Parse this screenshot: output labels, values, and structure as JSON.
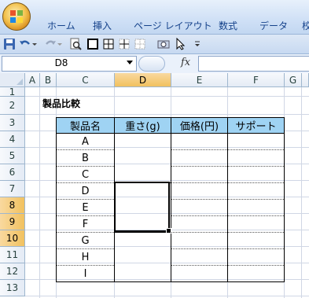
{
  "ribbon": {
    "tabs": [
      "ホーム",
      "挿入",
      "ページ レイアウト",
      "数式",
      "データ",
      "校"
    ]
  },
  "quick_access": {
    "icons": [
      "save-icon",
      "undo-icon",
      "redo-icon",
      "print-preview-icon",
      "border-icon",
      "all-borders-icon",
      "inner-borders-icon",
      "no-border-icon",
      "camera-icon",
      "select-objects-icon",
      "customize-dropdown-icon"
    ]
  },
  "formula_bar": {
    "name_box": "D8",
    "fx_label": "fx",
    "formula": ""
  },
  "grid": {
    "columns": [
      "A",
      "B",
      "C",
      "D",
      "E",
      "F",
      "G"
    ],
    "active_column": "D",
    "rows": [
      "1",
      "2",
      "3",
      "4",
      "5",
      "6",
      "7",
      "8",
      "9",
      "10",
      "11",
      "12",
      "13"
    ],
    "active_rows": [
      "8",
      "9",
      "10"
    ]
  },
  "sheet": {
    "title": "製品比較",
    "table": {
      "headers": [
        "製品名",
        "重さ(g)",
        "価格(円)",
        "サポート"
      ],
      "products": [
        "A",
        "B",
        "C",
        "D",
        "E",
        "F",
        "G",
        "H",
        "I"
      ]
    }
  },
  "colors": {
    "header_fill": "#9fd3f3",
    "active_header": "#f1c15f"
  }
}
